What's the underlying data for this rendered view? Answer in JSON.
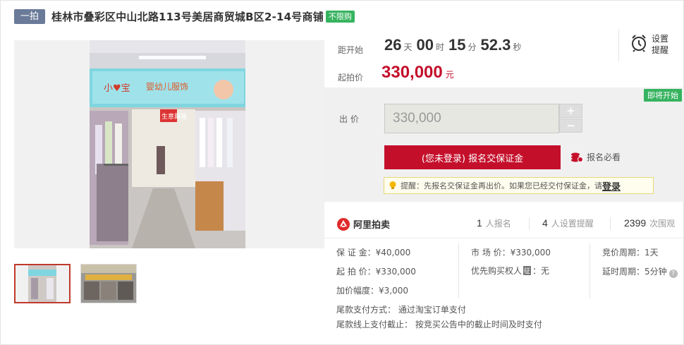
{
  "header": {
    "round_tag": "一拍",
    "title": "桂林市叠彩区中山北路113号美居商贸城B区2-14号商铺",
    "badge": "不限购"
  },
  "countdown": {
    "label": "距开始",
    "days": "26",
    "days_unit": "天",
    "hours": "00",
    "hours_unit": "时",
    "minutes": "15",
    "minutes_unit": "分",
    "seconds": "52.3",
    "seconds_unit": "秒",
    "remind_line1": "设置",
    "remind_line2": "提醒"
  },
  "price": {
    "label": "起拍价",
    "value": "330,000",
    "unit": "元"
  },
  "bid": {
    "soon_badge": "即将开始",
    "label": "出  价",
    "amount": "330,000",
    "plus": "+",
    "minus": "−",
    "register_label": "(您未登录) 报名交保证金",
    "must_read": "报名必看",
    "tip_text": "提醒：先报名交保证金再出价。如果您已经交付保证金，请",
    "tip_login": "登录"
  },
  "stats": {
    "brand": "阿里拍卖",
    "registered": "1",
    "registered_label": "人报名",
    "reminders": "4",
    "reminders_label": "人设置提醒",
    "views": "2399",
    "views_label": "次围观"
  },
  "info": {
    "deposit": "保 证 金：¥40,000",
    "start_price": "起 拍 价：¥330,000",
    "increment": "加价幅度：¥3,000",
    "market_price": "市 场 价：¥330,000",
    "priority_label": "优先购买权人",
    "priority_badge": "征",
    "priority_value": "：无",
    "bidding_period": "竞价周期：1天",
    "extension_period": "延时周期：5分钟",
    "help_glyph": "?",
    "payment_method": "尾款支付方式：  通过淘宝订单支付",
    "payment_deadline": "尾款线上支付截止：  按竞买公告中的截止时间及时支付"
  }
}
